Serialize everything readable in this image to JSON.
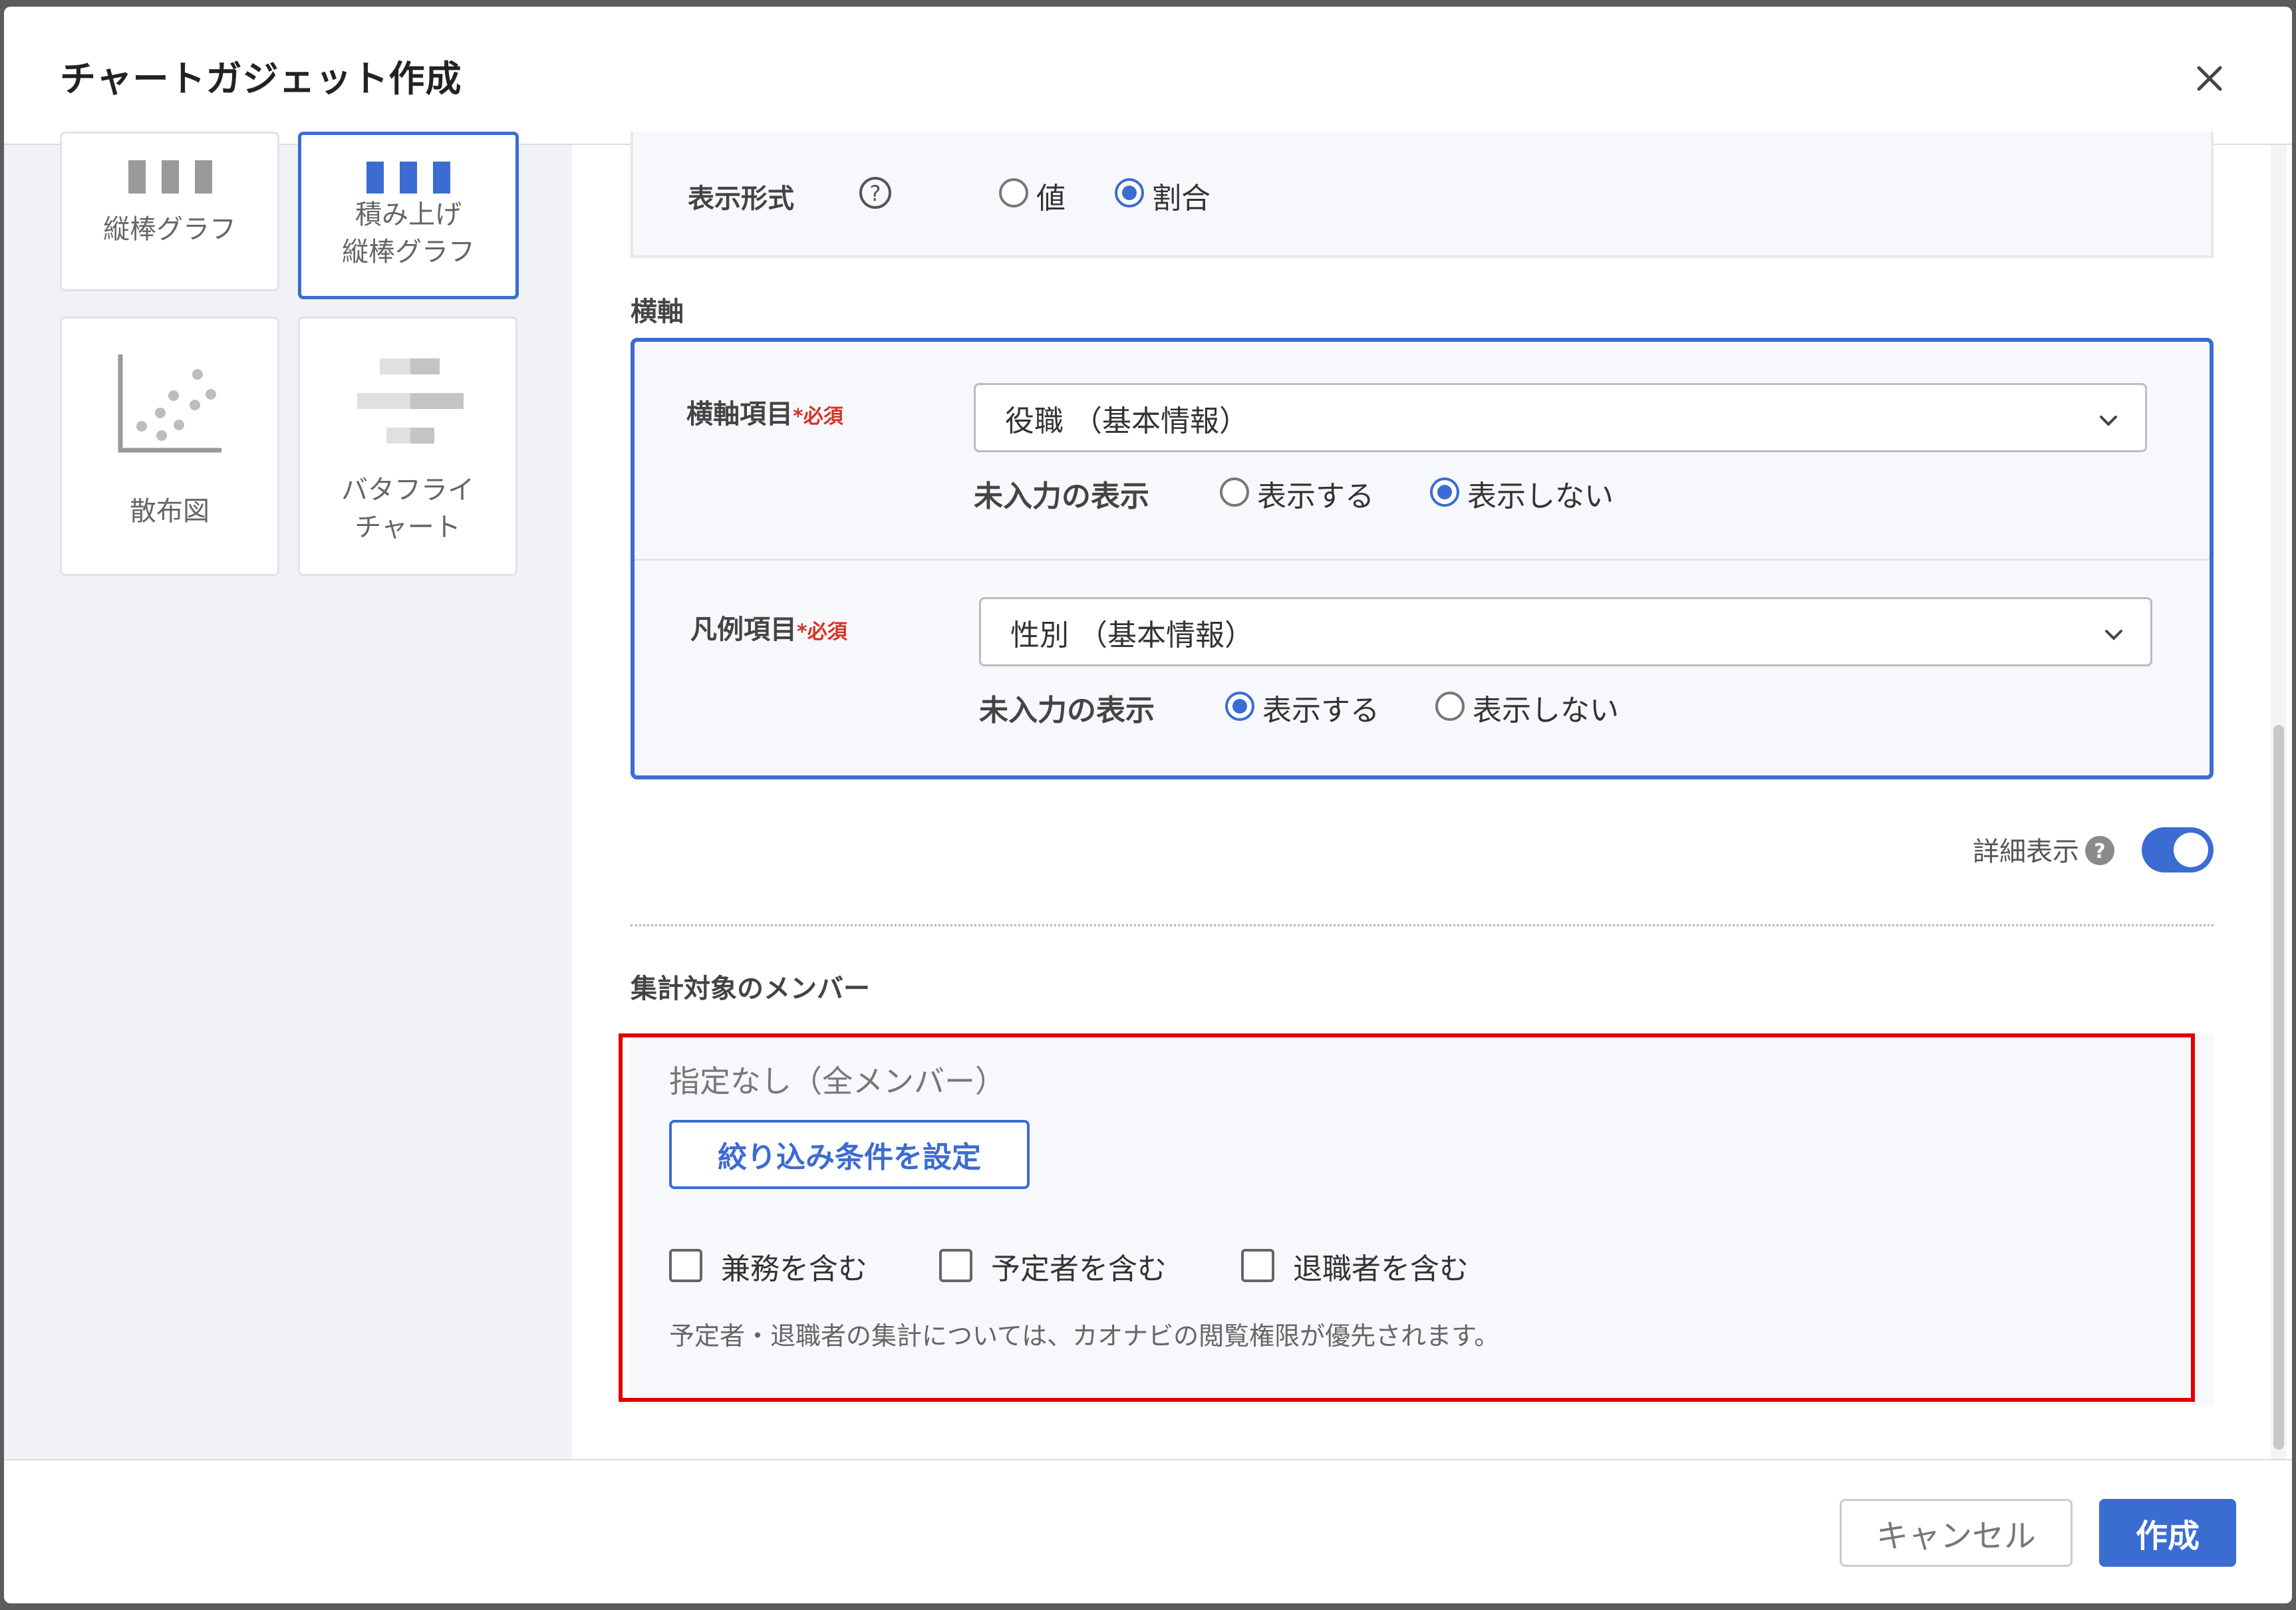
{
  "dialog": {
    "title": "チャートガジェット作成"
  },
  "chart_types": [
    {
      "label": "縦棒グラフ"
    },
    {
      "label_line1": "積み上げ",
      "label_line2": "縦棒グラフ"
    },
    {
      "label": "散布図"
    },
    {
      "label_line1": "バタフライ",
      "label_line2": "チャート"
    }
  ],
  "display_format": {
    "label": "表示形式",
    "options": [
      "値",
      "割合"
    ],
    "selected": "割合"
  },
  "x_axis": {
    "section_title": "横軸",
    "item": {
      "label": "横軸項目",
      "required_mark": "*",
      "required_text": "必須",
      "value": "役職 （基本情報）",
      "empty_label": "未入力の表示",
      "options": [
        "表示する",
        "表示しない"
      ],
      "selected": "表示しない"
    },
    "legend": {
      "label": "凡例項目",
      "required_mark": "*",
      "required_text": "必須",
      "value": "性別 （基本情報）",
      "empty_label": "未入力の表示",
      "options": [
        "表示する",
        "表示しない"
      ],
      "selected": "表示する"
    }
  },
  "detail_toggle": {
    "label": "詳細表示",
    "on": true
  },
  "members": {
    "section_title": "集計対象のメンバー",
    "status": "指定なし（全メンバー）",
    "filter_button": "絞り込み条件を設定",
    "checkboxes": [
      "兼務を含む",
      "予定者を含む",
      "退職者を含む"
    ],
    "note": "予定者・退職者の集計については、カオナビの閲覧権限が優先されます。"
  },
  "footer": {
    "cancel": "キャンセル",
    "create": "作成"
  },
  "colors": {
    "accent": "#3b6cd2",
    "highlight": "#e00000"
  }
}
